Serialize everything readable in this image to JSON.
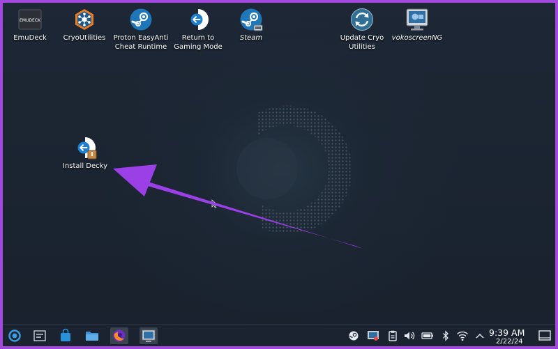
{
  "desktop_icons": [
    {
      "label": "EmuDeck",
      "icon": "emudeck-icon"
    },
    {
      "label": "CryoUtilities",
      "icon": "cryoutilities-icon"
    },
    {
      "label": "Proton EasyAnti Cheat Runtime",
      "icon": "steam-icon"
    },
    {
      "label": "Return to Gaming Mode",
      "icon": "return-arrow-icon"
    },
    {
      "label": "Steam",
      "icon": "steam-icon"
    },
    {
      "label": "Update Cryo Utilities",
      "icon": "refresh-icon"
    },
    {
      "label": "vokoscreenNG",
      "icon": "screen-recorder-icon"
    },
    {
      "label": "Install Decky",
      "icon": "install-arrow-icon"
    }
  ],
  "emudeck_logo_text": "EMUDECK",
  "taskbar": {
    "items": [
      "steamos-menu-icon",
      "task-switcher-icon",
      "store-icon",
      "files-icon",
      "firefox-icon",
      "vokoscreen-icon"
    ],
    "tray": [
      "steam-tray-icon",
      "screen-recorder-tray-icon",
      "clipboard-icon",
      "volume-icon",
      "battery-icon",
      "bluetooth-icon",
      "wifi-icon",
      "chevron-up-icon"
    ],
    "clock_time": "9:39 AM",
    "clock_date": "2/22/24"
  },
  "colors": {
    "frame": "#a349e0",
    "arrow": "#9b3fe6",
    "taskbar": "#1b2230"
  }
}
